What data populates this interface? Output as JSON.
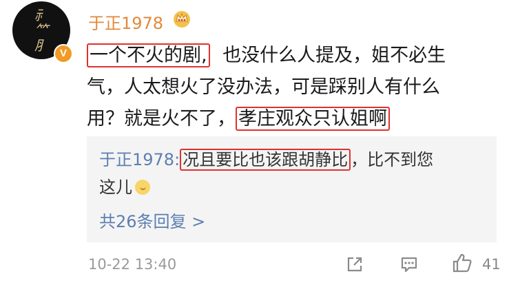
{
  "comment": {
    "username": "于正1978",
    "line1_hl": "一个不火的剧,",
    "line1_rest": "也没什么人提及，姐不必生",
    "line2": "气，人太想火了没办法，可是踩别人有什么",
    "line3_pre": "用？就是火不了，",
    "line3_hl": "孝庄观众只认姐啊",
    "timestamp": "10-22 13:40",
    "likes": "41"
  },
  "reply": {
    "user": "于正1978:",
    "hl": "况且要比也该跟胡静比",
    "rest": "，比不到您",
    "line2": "这儿",
    "count": "共26条回复 >"
  },
  "icons": {
    "avatar_badge": "V",
    "crown": "crown-icon",
    "share": "share-icon",
    "comment": "comment-icon",
    "like": "thumbs-up-icon"
  },
  "colors": {
    "username": "#e3883a",
    "highlight_border": "#e0302c",
    "reply_user": "#5c7eb1",
    "reply_bg": "#f4f4f4"
  }
}
